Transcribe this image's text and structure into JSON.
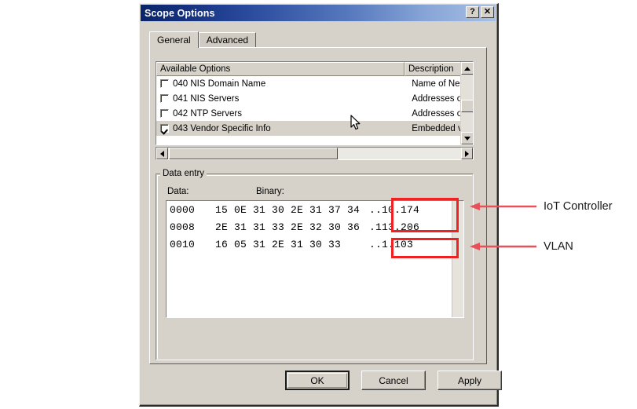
{
  "window": {
    "title": "Scope Options",
    "help_button": "?",
    "close_button": "✕"
  },
  "tabs": [
    {
      "label": "General",
      "active": true
    },
    {
      "label": "Advanced",
      "active": false
    }
  ],
  "list_view": {
    "columns": [
      "Available Options",
      "Description"
    ],
    "rows": [
      {
        "checked": false,
        "selected": false,
        "option": "040 NIS Domain Name",
        "description": "Name of Ne"
      },
      {
        "checked": false,
        "selected": false,
        "option": "041 NIS Servers",
        "description": "Addresses o"
      },
      {
        "checked": false,
        "selected": false,
        "option": "042 NTP Servers",
        "description": "Addresses o"
      },
      {
        "checked": true,
        "selected": true,
        "option": "043 Vendor Specific Info",
        "description": "Embedded v"
      }
    ]
  },
  "data_entry": {
    "legend": "Data entry",
    "label_data": "Data:",
    "label_binary": "Binary:",
    "rows": [
      {
        "offset": "0000",
        "bytes": "15 0E 31 30 2E 31 37 34",
        "ascii": "..10.174"
      },
      {
        "offset": "0008",
        "bytes": "2E 31 31 33 2E 32 30 36",
        "ascii": ".113.206"
      },
      {
        "offset": "0010",
        "bytes": "16 05 31 2E 31 30 33   ",
        "ascii": "..1.103"
      }
    ]
  },
  "buttons": {
    "ok": "OK",
    "cancel": "Cancel",
    "apply": "Apply"
  },
  "annotations": [
    {
      "label": "IoT Controller"
    },
    {
      "label": "VLAN"
    }
  ],
  "colors": {
    "annotation_red": "#ee2222",
    "dialog_face": "#d6d2c9",
    "title_bar_dark": "#0a246a",
    "title_bar_light": "#a8c0e4"
  }
}
